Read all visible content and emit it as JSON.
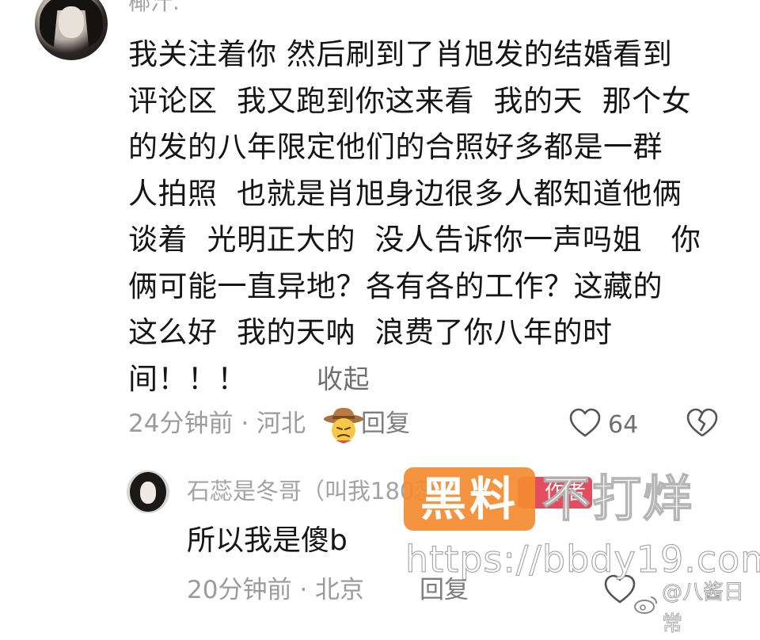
{
  "main_comment": {
    "username": "椰汁.",
    "lines": [
      "我关注着你 然后刷到了肖旭发的结婚看到",
      "评论区  我又跑到你这来看  我的天  那个女",
      "的发的八年限定他们的合照好多都是一群",
      "人拍照  也就是肖旭身边很多人都知道他俩",
      "谈着  光明正大的  没人告诉你一声吗姐   你",
      "俩可能一直异地？各有各的工作？这藏的",
      "这么好  我的天呐  浪费了你八年的时"
    ],
    "last_line": "间！！！",
    "emoji": "cowboy-emoji",
    "collapse_label": "收起",
    "time": "24分钟前",
    "separator": "·",
    "location": "河北",
    "reply_label": "回复",
    "like_count": "64"
  },
  "reply_comment": {
    "username": "石蕊是冬哥（叫我180蕊）",
    "author_tag": "作者",
    "text": "所以我是傻b",
    "time": "20分钟前",
    "separator": "·",
    "location": "北京",
    "reply_label": "回复"
  },
  "watermark": {
    "logo_text": "黑料",
    "slogan": "不打烊",
    "url": "https://bbdy19.com",
    "weibo_handle": "@八酱日常"
  },
  "colors": {
    "text_primary": "#151515",
    "text_meta": "#9b9b9b",
    "author_tag_bg": "#e24d5f",
    "watermark_orange": "#f38b30"
  }
}
